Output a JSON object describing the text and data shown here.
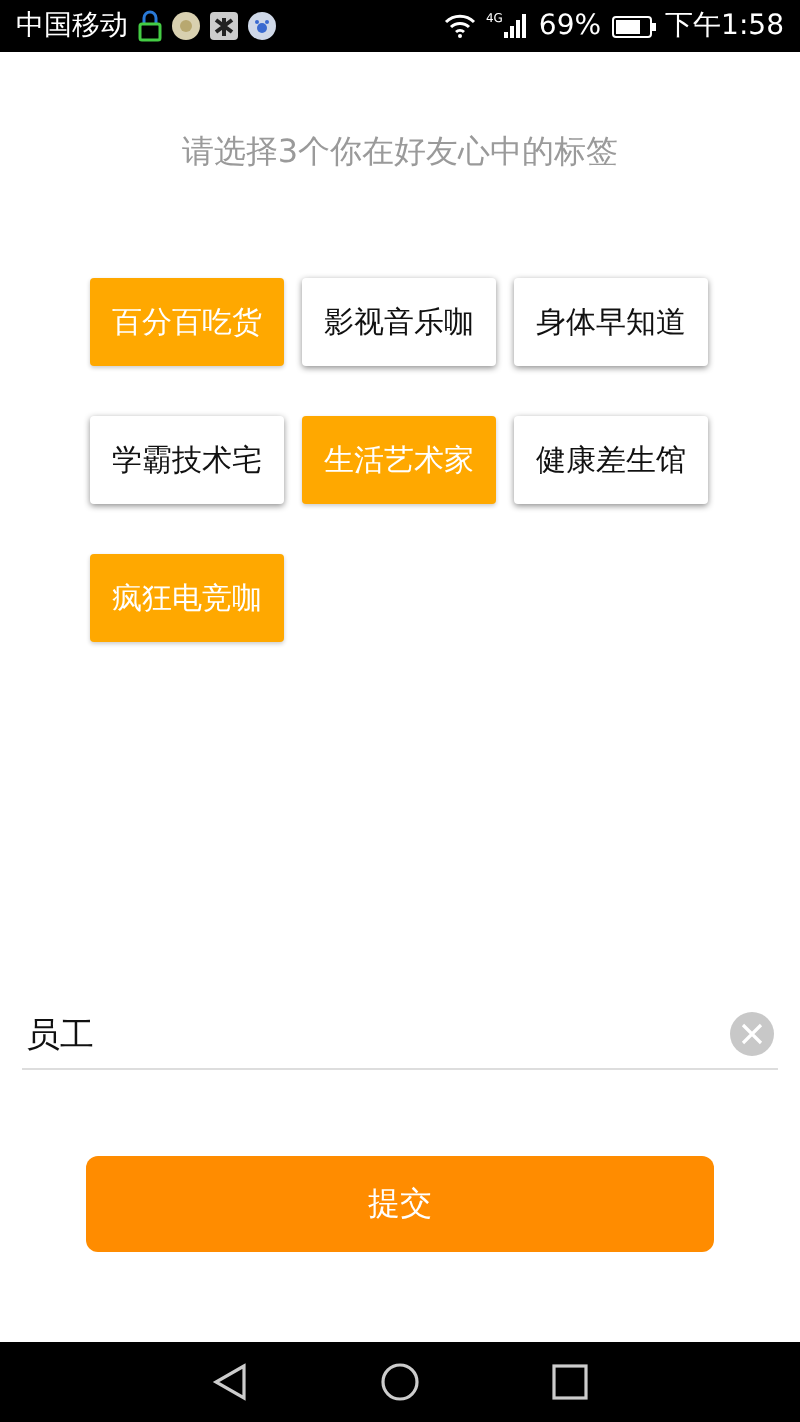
{
  "status_bar": {
    "carrier": "中国移动",
    "network": "4G",
    "battery": "69%",
    "time": "下午1:58"
  },
  "title": "请选择3个你在好友心中的标签",
  "tags": [
    {
      "label": "百分百吃货",
      "selected": true
    },
    {
      "label": "影视音乐咖",
      "selected": false
    },
    {
      "label": "身体早知道",
      "selected": false
    },
    {
      "label": "学霸技术宅",
      "selected": false
    },
    {
      "label": "生活艺术家",
      "selected": true
    },
    {
      "label": "健康差生馆",
      "selected": false
    },
    {
      "label": "疯狂电竞咖",
      "selected": true
    }
  ],
  "name_field": {
    "value": "员工"
  },
  "submit_button": "提交"
}
